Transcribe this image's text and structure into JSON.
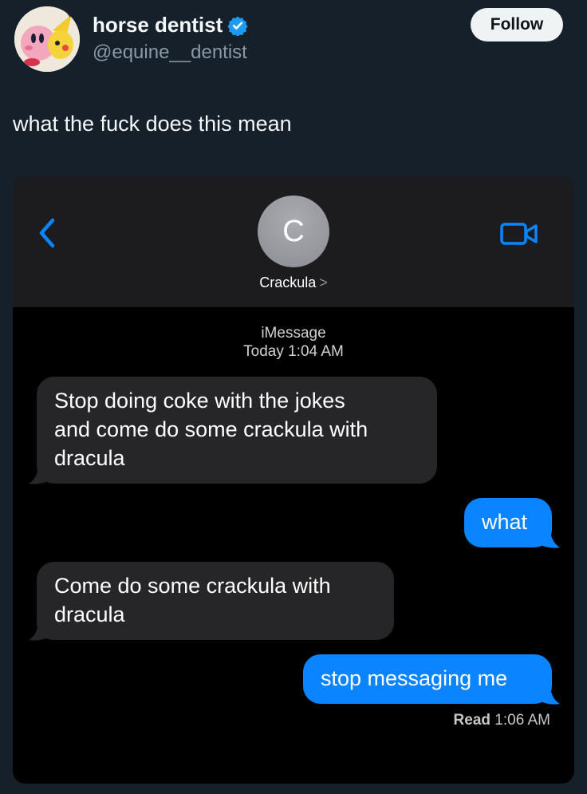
{
  "tweet": {
    "display_name": "horse dentist",
    "handle": "@equine__dentist",
    "verified": true,
    "follow_label": "Follow",
    "text": "what the fuck does this mean"
  },
  "imessage": {
    "contact_initial": "C",
    "contact_name": "Crackula",
    "contact_chevron": ">",
    "service": "iMessage",
    "timestamp": "Today 1:04 AM",
    "messages": [
      {
        "direction": "incoming",
        "lines": [
          "Stop doing coke with the jokes",
          "and come do some crackula with",
          "dracula"
        ]
      },
      {
        "direction": "outgoing",
        "lines": [
          "what"
        ]
      },
      {
        "direction": "incoming",
        "lines": [
          "Come do some crackula with",
          "dracula"
        ]
      },
      {
        "direction": "outgoing",
        "lines": [
          "stop messaging me"
        ]
      }
    ],
    "read_label": "Read",
    "read_time": "1:06 AM"
  },
  "icons": {
    "back": "chevron-left-icon",
    "video": "video-camera-icon",
    "verified": "verified-badge-icon"
  },
  "colors": {
    "background": "#15202b",
    "accent_blue": "#0a84ff",
    "verified_blue": "#1d9bf0",
    "incoming_bubble": "#262628"
  }
}
